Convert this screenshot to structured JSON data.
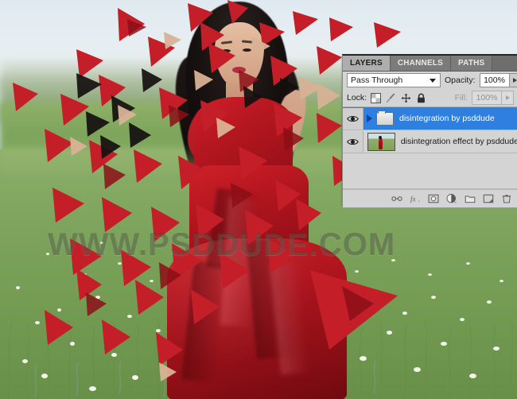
{
  "app": {
    "name": "Adobe Photoshop",
    "document_subject": "Woman in red dress disintegration effect photo manipulation"
  },
  "photo": {
    "watermark": "WWW.PSDDUDE.COM",
    "scene": "woman in red dress standing in a flowering green meadow with blue sky",
    "effect_color": "#c41e28",
    "shard_dark_color": "#141010",
    "shard_skin_color": "#d9b295"
  },
  "panel": {
    "tabs": [
      {
        "label": "LAYERS",
        "active": true
      },
      {
        "label": "CHANNELS",
        "active": false
      },
      {
        "label": "PATHS",
        "active": false
      }
    ],
    "blend_mode": "Pass Through",
    "opacity_label": "Opacity:",
    "opacity_value": "100%",
    "lock_label": "Lock:",
    "lock_icons": [
      "lock-transparent-pixels-icon",
      "lock-image-pixels-icon",
      "lock-position-icon",
      "lock-all-icon"
    ],
    "fill_label": "Fill:",
    "fill_value": "100%",
    "layers": [
      {
        "name": "disintegration by psddude",
        "type": "group",
        "visible": true,
        "selected": true,
        "expanded": false
      },
      {
        "name": "disintegration effect by psddude",
        "type": "image",
        "visible": true,
        "selected": false,
        "expanded": false
      }
    ],
    "bottom_buttons": [
      {
        "name": "link-layers-icon",
        "title": "Link layers"
      },
      {
        "name": "layer-style-fx-icon",
        "title": "Add a layer style"
      },
      {
        "name": "add-layer-mask-icon",
        "title": "Add layer mask"
      },
      {
        "name": "new-adjustment-layer-icon",
        "title": "Create new fill or adjustment layer"
      },
      {
        "name": "new-group-icon",
        "title": "Create a new group"
      },
      {
        "name": "new-layer-icon",
        "title": "Create a new layer"
      },
      {
        "name": "delete-layer-icon",
        "title": "Delete layer"
      }
    ],
    "colors": {
      "panel_bg": "#d4d4d4",
      "tab_bar_bg": "#6e6e6e",
      "tab_active_bg": "#aeaeae",
      "selection_blue": "#2f7fe0",
      "field_bg": "#ffffff",
      "disabled_text": "#9a9a9a"
    }
  }
}
